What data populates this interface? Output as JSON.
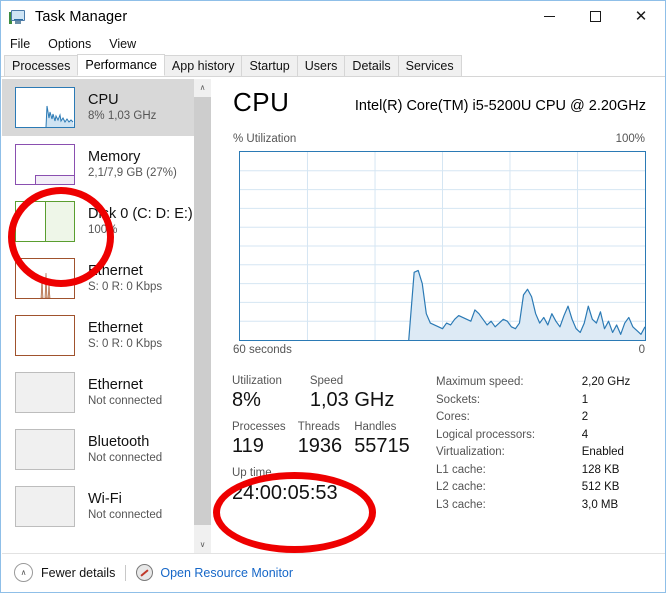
{
  "window": {
    "title": "Task Manager",
    "icon": "task-manager-icon",
    "minimize": "—",
    "maximize": "□",
    "close": "✕"
  },
  "menu": {
    "items": [
      "File",
      "Options",
      "View"
    ]
  },
  "tabs": {
    "items": [
      "Processes",
      "Performance",
      "App history",
      "Startup",
      "Users",
      "Details",
      "Services"
    ],
    "active": "Performance"
  },
  "sidebar": {
    "items": [
      {
        "title": "CPU",
        "sub": "8%  1,03 GHz",
        "color": "#2b7ab5",
        "style": "graph",
        "selected": true
      },
      {
        "title": "Memory",
        "sub": "2,1/7,9 GB (27%)",
        "color": "#8a4fb0",
        "style": "partial",
        "selected": false
      },
      {
        "title": "Disk 0 (C: D: E:)",
        "sub": "100%",
        "color": "#5a9e2f",
        "style": "half",
        "selected": false
      },
      {
        "title": "Ethernet",
        "sub": "S: 0 R: 0 Kbps",
        "color": "#a0522d",
        "style": "spikes",
        "selected": false
      },
      {
        "title": "Ethernet",
        "sub": "S: 0 R: 0 Kbps",
        "color": "#a0522d",
        "style": "empty",
        "selected": false
      },
      {
        "title": "Ethernet",
        "sub": "Not connected",
        "color": "#bdbdbd",
        "style": "disabled",
        "selected": false
      },
      {
        "title": "Bluetooth",
        "sub": "Not connected",
        "color": "#bdbdbd",
        "style": "disabled",
        "selected": false
      },
      {
        "title": "Wi-Fi",
        "sub": "Not connected",
        "color": "#bdbdbd",
        "style": "disabled",
        "selected": false
      }
    ],
    "scroll_up": "∧",
    "scroll_down": "∨"
  },
  "main": {
    "heading": "CPU",
    "model": "Intel(R) Core(TM) i5-5200U CPU @ 2.20GHz",
    "axis_top_left": "% Utilization",
    "axis_top_right": "100%",
    "axis_bottom_left": "60 seconds",
    "axis_bottom_right": "0",
    "stats_primary": [
      [
        {
          "label": "Utilization",
          "value": "8%"
        },
        {
          "label": "Speed",
          "value": "1,03 GHz"
        }
      ],
      [
        {
          "label": "Processes",
          "value": "119"
        },
        {
          "label": "Threads",
          "value": "1936"
        },
        {
          "label": "Handles",
          "value": "55715"
        }
      ],
      [
        {
          "label": "Up time",
          "value": "24:00:05:53"
        }
      ]
    ],
    "stats_secondary": [
      {
        "key": "Maximum speed:",
        "value": "2,20 GHz"
      },
      {
        "key": "Sockets:",
        "value": "1"
      },
      {
        "key": "Cores:",
        "value": "2"
      },
      {
        "key": "Logical processors:",
        "value": "4"
      },
      {
        "key": "Virtualization:",
        "value": "Enabled"
      },
      {
        "key": "L1 cache:",
        "value": "128 KB"
      },
      {
        "key": "L2 cache:",
        "value": "512 KB"
      },
      {
        "key": "L3 cache:",
        "value": "3,0 MB"
      }
    ]
  },
  "chart_data": {
    "type": "area",
    "title": "% Utilization",
    "xlabel": "60 seconds",
    "ylabel": "% Utilization",
    "ylim": [
      0,
      100
    ],
    "xlim": [
      60,
      0
    ],
    "grid": true,
    "legend": "none",
    "line_color": "#2b7ab5",
    "fill_color": "#ddeaf5",
    "note": "No data recorded for the first ~56% of the window; trace begins partway across",
    "x": [
      60,
      35,
      34.2,
      33.6,
      33,
      32.4,
      31.8,
      31.2,
      30.6,
      30,
      29.4,
      28.8,
      28.2,
      27.6,
      27,
      26.4,
      25.8,
      25.2,
      24.6,
      24,
      23.4,
      22.8,
      22.2,
      21.6,
      21,
      20.4,
      19.8,
      19.2,
      18.6,
      18,
      17.4,
      16.8,
      16.2,
      15.6,
      15,
      14.4,
      13.8,
      13.2,
      12.6,
      12,
      11.4,
      10.8,
      10.2,
      9.6,
      9,
      8.4,
      7.8,
      7.2,
      6.6,
      6,
      5.4,
      4.8,
      4.2,
      3.6,
      3,
      2.4,
      1.8,
      1.2,
      0.6,
      0
    ],
    "values": [
      0,
      0,
      36,
      37,
      30,
      14,
      9,
      8,
      7,
      6,
      9,
      8,
      11,
      13,
      12,
      11,
      10,
      16,
      14,
      11,
      8,
      10,
      7,
      9,
      11,
      10,
      7,
      6,
      9,
      24,
      27,
      23,
      14,
      9,
      12,
      8,
      14,
      10,
      7,
      13,
      18,
      11,
      6,
      4,
      9,
      18,
      11,
      9,
      15,
      6,
      10,
      4,
      8,
      3,
      9,
      12,
      7,
      5,
      3,
      7
    ]
  },
  "statusbar": {
    "chevron": "∧",
    "fewer_details": "Fewer details",
    "resource_monitor_icon": "resource-monitor-icon",
    "resource_monitor": "Open Resource Monitor"
  },
  "annotations": [
    {
      "name": "disk-highlight",
      "shape": "circle",
      "color": "#ee0000"
    },
    {
      "name": "uptime-highlight",
      "shape": "ellipse",
      "color": "#ee0000"
    }
  ]
}
